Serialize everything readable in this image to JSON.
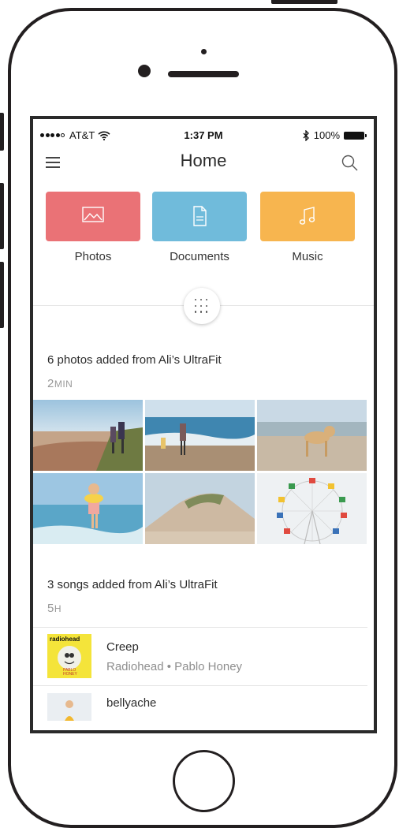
{
  "status_bar": {
    "carrier": "AT&T",
    "time": "1:37 PM",
    "battery": "100%"
  },
  "nav": {
    "title": "Home"
  },
  "categories": [
    {
      "label": "Photos",
      "color": "#ea7276"
    },
    {
      "label": "Documents",
      "color": "#70bbdb"
    },
    {
      "label": "Music",
      "color": "#f7b54f"
    }
  ],
  "activity_photos": {
    "title": "6 photos added from Ali’s UltraFit",
    "time_num": "2",
    "time_unit": "MIN"
  },
  "activity_songs": {
    "title": "3 songs added from Ali’s UltraFit",
    "time_num": "5",
    "time_unit": "H",
    "songs": [
      {
        "title": "Creep",
        "subtitle": "Radiohead • Pablo Honey",
        "album_text": "radiohead",
        "album_sub": "PABLO HONEY"
      },
      {
        "title": "bellyache",
        "subtitle": ""
      }
    ]
  }
}
